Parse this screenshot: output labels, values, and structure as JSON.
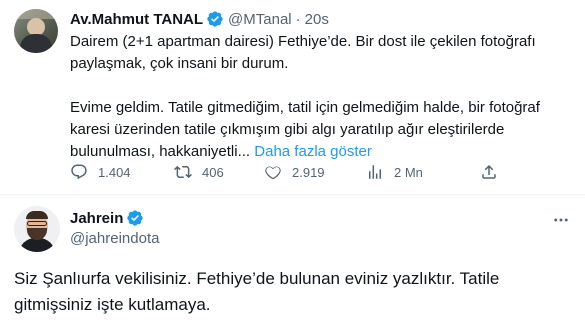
{
  "quoted_tweet": {
    "author_name": "Av.Mahmut TANAL",
    "handle": "@MTanal",
    "separator": "·",
    "time": "20s",
    "paragraph1": "Dairem (2+1 apartman dairesi) Fethiye’de. Bir dost ile çekilen fotoğrafı paylaşmak, çok insani bir durum.",
    "paragraph2": "Evime geldim. Tatile gitmediğim, tatil için gelmediğim halde, bir fotoğraf karesi üzerinden tatile çıkmışım gibi algı yaratılıp ağır eleştirilerde bulunulması, hakkaniyetli...",
    "show_more": "Daha fazla göster",
    "actions": {
      "replies": "1.404",
      "retweets": "406",
      "likes": "2.919",
      "views": "2 Mn"
    }
  },
  "reply_tweet": {
    "author_name": "Jahrein",
    "handle": "@jahreindota",
    "text": "Siz Şanlıurfa vekilisiniz. Fethiye’de bulunan eviniz yazlıktır. Tatile gitmişsiniz işte kutlamaya."
  },
  "icons": {
    "verified": "verified-badge-icon",
    "reply": "reply-icon",
    "retweet": "retweet-icon",
    "like": "heart-icon",
    "views": "views-icon",
    "share": "share-icon",
    "more": "more-icon"
  },
  "colors": {
    "accent": "#1d9bf0",
    "text": "#0f1419",
    "muted": "#536471",
    "divider": "#eff3f4"
  }
}
